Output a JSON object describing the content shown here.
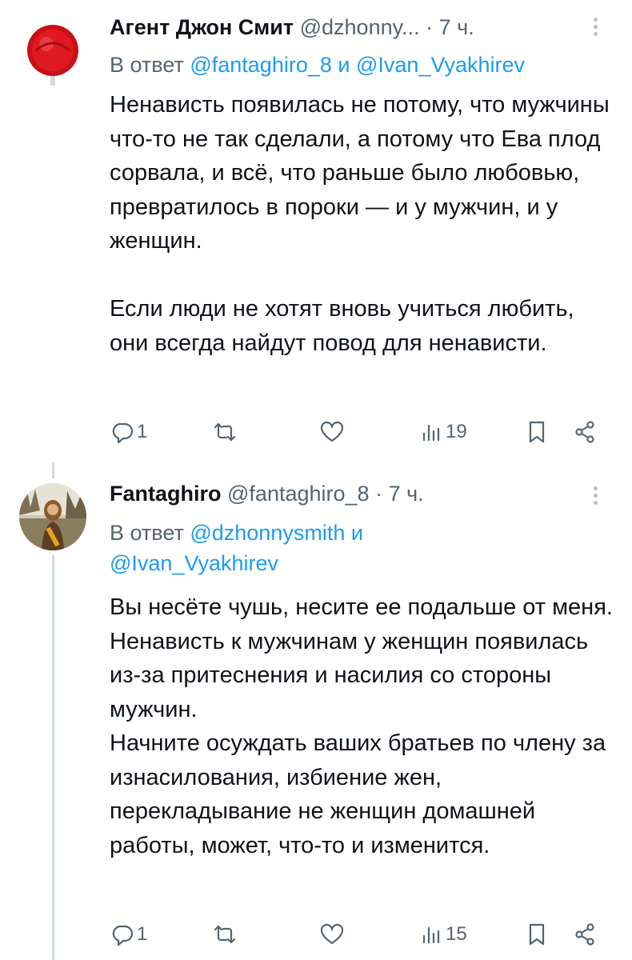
{
  "tweets": [
    {
      "name": "Агент Джон Смит",
      "handle": "@dzhonny...",
      "dot": "·",
      "time": "7 ч.",
      "reply_prefix": "В ответ",
      "reply_mention_1": "@fantaghiro_8",
      "reply_and": "и",
      "reply_mention_2": "@Ivan_Vyakhirev",
      "text": "Ненависть появилась не потому, что мужчины что-то не так сделали, а потому что Ева плод сорвала, и всё, что раньше было любовью, превратилось в пороки — и у мужчин, и у женщин.\n\nЕсли люди не хотят вновь учиться любить, они всегда найдут повод для ненависти.",
      "reply_count": "1",
      "retweet_count": "",
      "like_count": "",
      "views_count": "19",
      "avatar_icon": "red-lollipop-avatar"
    },
    {
      "name": "Fantaghiro",
      "handle": "@fantaghiro_8",
      "dot": "·",
      "time": "7 ч.",
      "reply_prefix": "В ответ",
      "reply_mention_1": "@dzhonnysmith",
      "reply_and": "и",
      "reply_mention_2": "@Ivan_Vyakhirev",
      "text": "Вы несёте чушь, несите ее подальше от меня.\nНенависть к мужчинам у женщин появилась из-за притеснения и насилия со стороны мужчин.\nНачните осуждать ваших братьев по члену за изнасилования, избиение жен, перекладывание не женщин домашней работы, может, что-то и изменится.",
      "reply_count": "1",
      "retweet_count": "",
      "like_count": "",
      "views_count": "15",
      "avatar_icon": "person-photo-avatar"
    }
  ],
  "icons": {
    "reply": "reply-icon",
    "retweet": "retweet-icon",
    "like": "heart-icon",
    "views": "views-icon",
    "bookmark": "bookmark-icon",
    "share": "share-icon",
    "more": "more-options-icon"
  },
  "colors": {
    "mention": "#1d9bf0",
    "secondary_text": "#536471",
    "primary_text": "#0f1419"
  }
}
